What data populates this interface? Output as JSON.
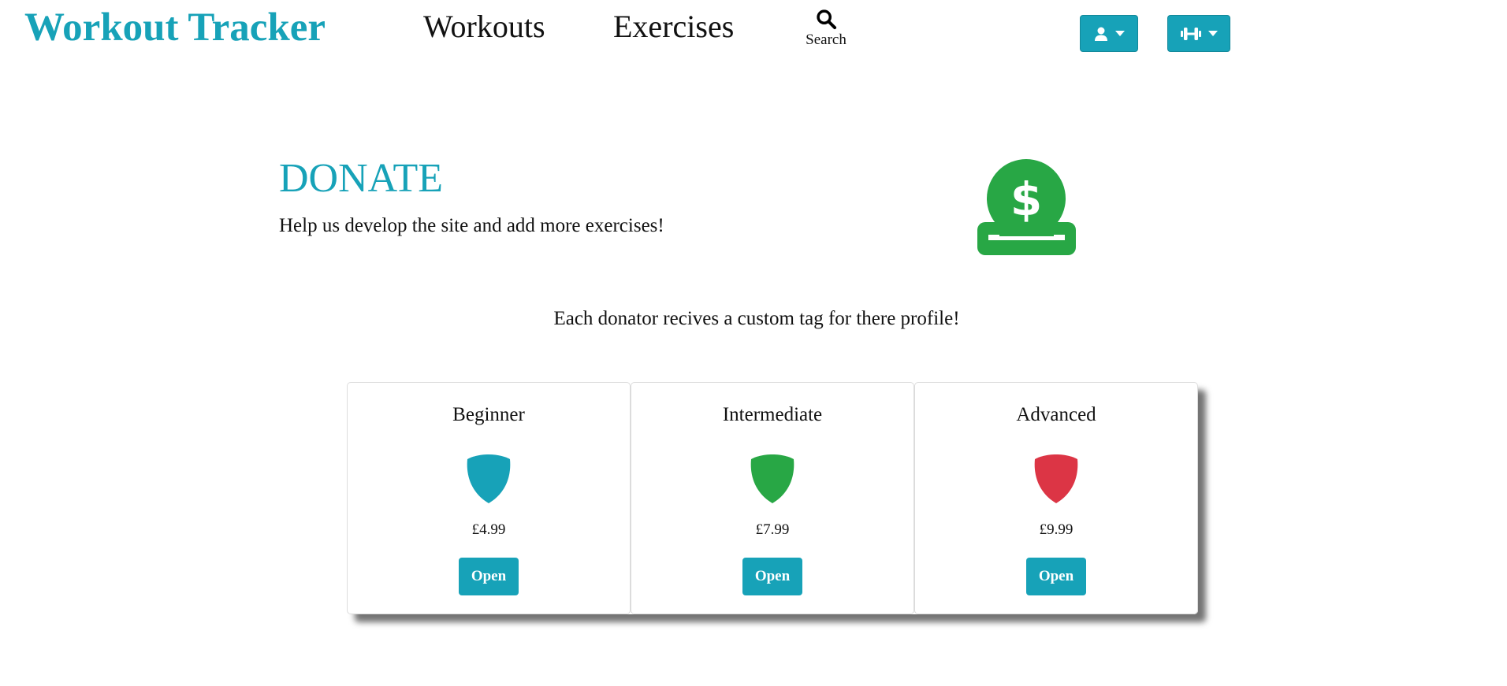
{
  "nav": {
    "brand": "Workout Tracker",
    "links": [
      {
        "label": "Workouts"
      },
      {
        "label": "Exercises"
      }
    ],
    "search_label": "Search",
    "user_menu_icon": "user-icon",
    "workout_menu_icon": "dumbbell-icon"
  },
  "donate": {
    "title": "DONATE",
    "subtitle": "Help us develop the site and add more exercises!",
    "icon": "hand-holding-dollar-icon",
    "note": "Each donator recives a custom tag for there profile!"
  },
  "tiers": [
    {
      "name": "Beginner",
      "price": "£4.99",
      "button": "Open",
      "color": "#17a2b8",
      "icon": "shield-icon"
    },
    {
      "name": "Intermediate",
      "price": "£7.99",
      "button": "Open",
      "color": "#28a745",
      "icon": "shield-icon"
    },
    {
      "name": "Advanced",
      "price": "£9.99",
      "button": "Open",
      "color": "#dc3545",
      "icon": "shield-icon"
    }
  ],
  "colors": {
    "accent": "#17a2b8",
    "success": "#28a745",
    "danger": "#dc3545"
  }
}
